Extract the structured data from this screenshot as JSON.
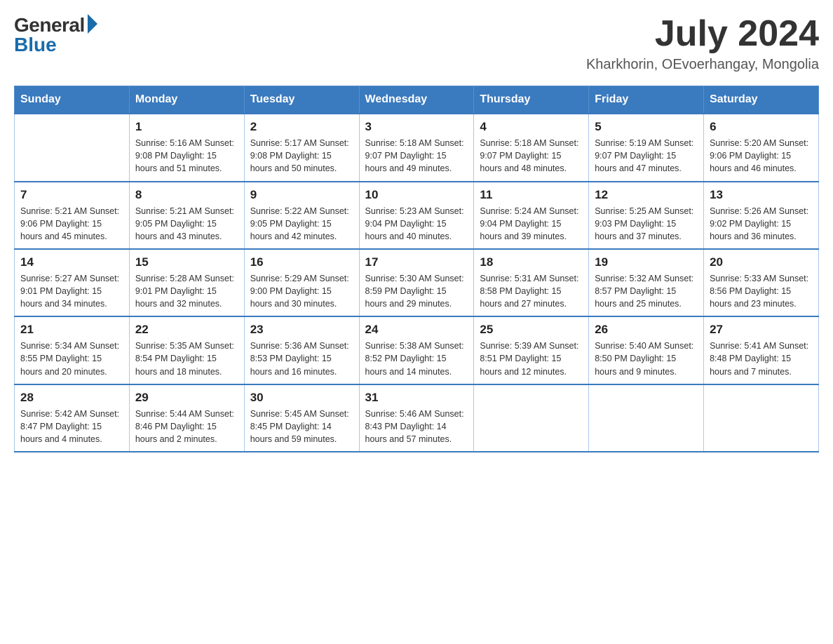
{
  "header": {
    "logo_general": "General",
    "logo_blue": "Blue",
    "month_year": "July 2024",
    "location": "Kharkhorin, OEvoerhangay, Mongolia"
  },
  "days_of_week": [
    "Sunday",
    "Monday",
    "Tuesday",
    "Wednesday",
    "Thursday",
    "Friday",
    "Saturday"
  ],
  "weeks": [
    [
      {
        "day": "",
        "info": ""
      },
      {
        "day": "1",
        "info": "Sunrise: 5:16 AM\nSunset: 9:08 PM\nDaylight: 15 hours\nand 51 minutes."
      },
      {
        "day": "2",
        "info": "Sunrise: 5:17 AM\nSunset: 9:08 PM\nDaylight: 15 hours\nand 50 minutes."
      },
      {
        "day": "3",
        "info": "Sunrise: 5:18 AM\nSunset: 9:07 PM\nDaylight: 15 hours\nand 49 minutes."
      },
      {
        "day": "4",
        "info": "Sunrise: 5:18 AM\nSunset: 9:07 PM\nDaylight: 15 hours\nand 48 minutes."
      },
      {
        "day": "5",
        "info": "Sunrise: 5:19 AM\nSunset: 9:07 PM\nDaylight: 15 hours\nand 47 minutes."
      },
      {
        "day": "6",
        "info": "Sunrise: 5:20 AM\nSunset: 9:06 PM\nDaylight: 15 hours\nand 46 minutes."
      }
    ],
    [
      {
        "day": "7",
        "info": "Sunrise: 5:21 AM\nSunset: 9:06 PM\nDaylight: 15 hours\nand 45 minutes."
      },
      {
        "day": "8",
        "info": "Sunrise: 5:21 AM\nSunset: 9:05 PM\nDaylight: 15 hours\nand 43 minutes."
      },
      {
        "day": "9",
        "info": "Sunrise: 5:22 AM\nSunset: 9:05 PM\nDaylight: 15 hours\nand 42 minutes."
      },
      {
        "day": "10",
        "info": "Sunrise: 5:23 AM\nSunset: 9:04 PM\nDaylight: 15 hours\nand 40 minutes."
      },
      {
        "day": "11",
        "info": "Sunrise: 5:24 AM\nSunset: 9:04 PM\nDaylight: 15 hours\nand 39 minutes."
      },
      {
        "day": "12",
        "info": "Sunrise: 5:25 AM\nSunset: 9:03 PM\nDaylight: 15 hours\nand 37 minutes."
      },
      {
        "day": "13",
        "info": "Sunrise: 5:26 AM\nSunset: 9:02 PM\nDaylight: 15 hours\nand 36 minutes."
      }
    ],
    [
      {
        "day": "14",
        "info": "Sunrise: 5:27 AM\nSunset: 9:01 PM\nDaylight: 15 hours\nand 34 minutes."
      },
      {
        "day": "15",
        "info": "Sunrise: 5:28 AM\nSunset: 9:01 PM\nDaylight: 15 hours\nand 32 minutes."
      },
      {
        "day": "16",
        "info": "Sunrise: 5:29 AM\nSunset: 9:00 PM\nDaylight: 15 hours\nand 30 minutes."
      },
      {
        "day": "17",
        "info": "Sunrise: 5:30 AM\nSunset: 8:59 PM\nDaylight: 15 hours\nand 29 minutes."
      },
      {
        "day": "18",
        "info": "Sunrise: 5:31 AM\nSunset: 8:58 PM\nDaylight: 15 hours\nand 27 minutes."
      },
      {
        "day": "19",
        "info": "Sunrise: 5:32 AM\nSunset: 8:57 PM\nDaylight: 15 hours\nand 25 minutes."
      },
      {
        "day": "20",
        "info": "Sunrise: 5:33 AM\nSunset: 8:56 PM\nDaylight: 15 hours\nand 23 minutes."
      }
    ],
    [
      {
        "day": "21",
        "info": "Sunrise: 5:34 AM\nSunset: 8:55 PM\nDaylight: 15 hours\nand 20 minutes."
      },
      {
        "day": "22",
        "info": "Sunrise: 5:35 AM\nSunset: 8:54 PM\nDaylight: 15 hours\nand 18 minutes."
      },
      {
        "day": "23",
        "info": "Sunrise: 5:36 AM\nSunset: 8:53 PM\nDaylight: 15 hours\nand 16 minutes."
      },
      {
        "day": "24",
        "info": "Sunrise: 5:38 AM\nSunset: 8:52 PM\nDaylight: 15 hours\nand 14 minutes."
      },
      {
        "day": "25",
        "info": "Sunrise: 5:39 AM\nSunset: 8:51 PM\nDaylight: 15 hours\nand 12 minutes."
      },
      {
        "day": "26",
        "info": "Sunrise: 5:40 AM\nSunset: 8:50 PM\nDaylight: 15 hours\nand 9 minutes."
      },
      {
        "day": "27",
        "info": "Sunrise: 5:41 AM\nSunset: 8:48 PM\nDaylight: 15 hours\nand 7 minutes."
      }
    ],
    [
      {
        "day": "28",
        "info": "Sunrise: 5:42 AM\nSunset: 8:47 PM\nDaylight: 15 hours\nand 4 minutes."
      },
      {
        "day": "29",
        "info": "Sunrise: 5:44 AM\nSunset: 8:46 PM\nDaylight: 15 hours\nand 2 minutes."
      },
      {
        "day": "30",
        "info": "Sunrise: 5:45 AM\nSunset: 8:45 PM\nDaylight: 14 hours\nand 59 minutes."
      },
      {
        "day": "31",
        "info": "Sunrise: 5:46 AM\nSunset: 8:43 PM\nDaylight: 14 hours\nand 57 minutes."
      },
      {
        "day": "",
        "info": ""
      },
      {
        "day": "",
        "info": ""
      },
      {
        "day": "",
        "info": ""
      }
    ]
  ]
}
